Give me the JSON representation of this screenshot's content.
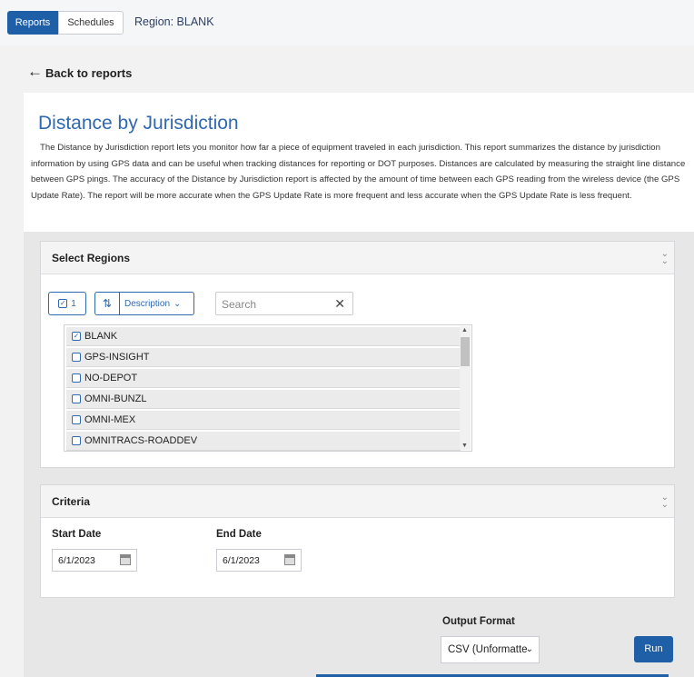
{
  "tabs": [
    "Reports",
    "Schedules"
  ],
  "region_label": "Region: BLANK",
  "back_label": "Back to reports",
  "report": {
    "title": "Distance by Jurisdiction",
    "description": "The Distance by Jurisdiction report lets you monitor how far a piece of equipment traveled in each jurisdiction. This report summarizes the distance by jurisdiction information by using GPS data and can be useful when tracking distances for reporting or DOT purposes. Distances are calculated by measuring the straight line distance between GPS pings. The accuracy of the Distance by Jurisdiction report is affected by the amount of time between each GPS reading from the wireless device (the GPS Update Rate). The report will be more accurate when the GPS Update Rate is more frequent and less accurate when the GPS Update Rate is less frequent."
  },
  "regions": {
    "header": "Select Regions",
    "selected_count": "1",
    "sort_by": "Description",
    "search_placeholder": "Search",
    "items": [
      {
        "label": "BLANK",
        "checked": true
      },
      {
        "label": "GPS-INSIGHT",
        "checked": false
      },
      {
        "label": "NO-DEPOT",
        "checked": false
      },
      {
        "label": "OMNI-BUNZL",
        "checked": false
      },
      {
        "label": "OMNI-MEX",
        "checked": false
      },
      {
        "label": "OMNITRACS-ROADDEV",
        "checked": false
      }
    ]
  },
  "criteria": {
    "header": "Criteria",
    "start_label": "Start Date",
    "start_value": "6/1/2023",
    "end_label": "End Date",
    "end_value": "6/1/2023"
  },
  "output": {
    "label": "Output Format",
    "value": "CSV (Unformatte",
    "run_label": "Run"
  },
  "colors": {
    "accent": "#1e5fa8",
    "title": "#2f69b0"
  }
}
